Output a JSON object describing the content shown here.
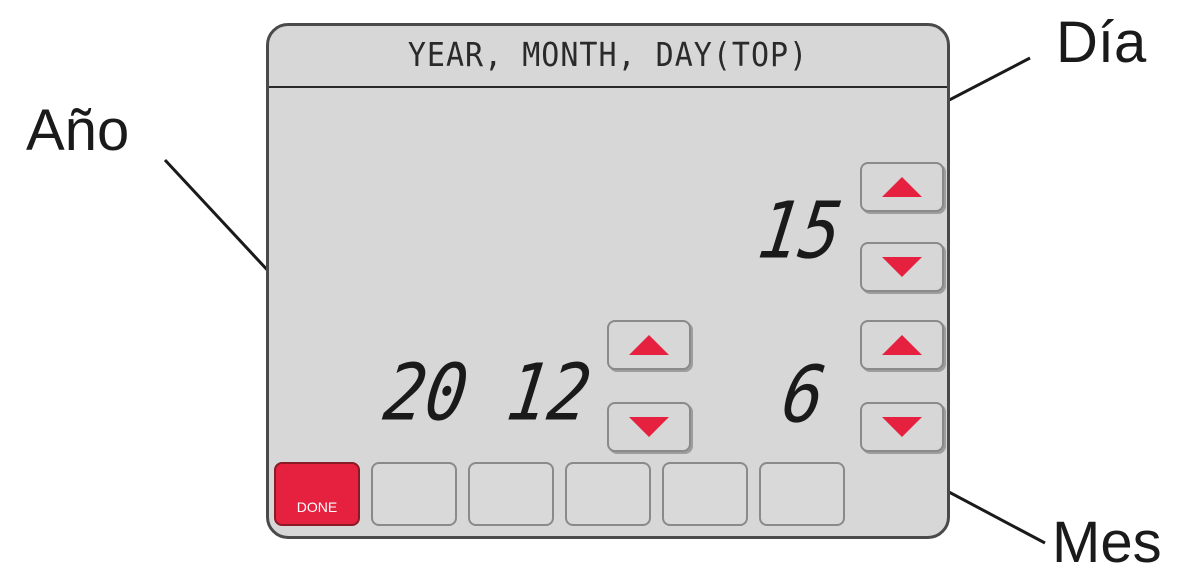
{
  "callouts": {
    "year": "Año",
    "day": "Día",
    "month": "Mes"
  },
  "screen": {
    "title": "YEAR, MONTH, DAY(TOP)",
    "year_value": "20 12",
    "day_value": "15",
    "month_value": "6",
    "done_label": "DONE"
  },
  "colors": {
    "accent": "#e6203f",
    "screen_bg": "#d7d7d7"
  },
  "icons": {
    "up": "triangle-up",
    "down": "triangle-down"
  }
}
